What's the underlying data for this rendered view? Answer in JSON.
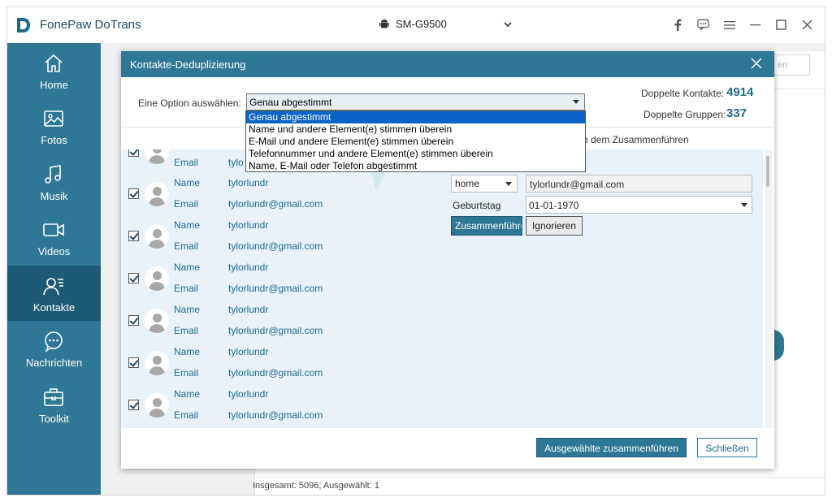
{
  "app": {
    "title": "FonePaw DoTrans",
    "device": "SM-G9500"
  },
  "sidebar": {
    "items": [
      {
        "label": "Home",
        "icon": "home-icon"
      },
      {
        "label": "Fotos",
        "icon": "photo-icon"
      },
      {
        "label": "Musik",
        "icon": "music-icon"
      },
      {
        "label": "Videos",
        "icon": "video-icon"
      },
      {
        "label": "Kontakte",
        "icon": "contacts-icon",
        "active": true
      },
      {
        "label": "Nachrichten",
        "icon": "message-icon"
      },
      {
        "label": "Toolkit",
        "icon": "toolkit-icon"
      }
    ]
  },
  "background": {
    "search_hint": "en",
    "status": "Insgesamt: 5096; Ausgewählt: 1"
  },
  "dialog": {
    "title": "Kontakte-Deduplizierung",
    "option_label": "Eine Option auswählen:",
    "selected_option": "Genau abgestimmt",
    "options": [
      "Genau abgestimmt",
      "Name und andere Element(e) stimmen überein",
      "E-Mail und andere Element(e) stimmen überein",
      "Telefonnummer und andere Element(e) stimmen überein",
      "Name, E-Mail oder Telefon abgestimmt"
    ],
    "stats": {
      "dup_contacts_label": "Doppelte Kontakte:",
      "dup_contacts_value": "4914",
      "dup_groups_label": "Doppelte Gruppen:",
      "dup_groups_value": "337"
    },
    "merge_hint": "ch dem Zusammenführen",
    "rows": [
      {
        "name_label": "Name",
        "name": "tylorlundr",
        "email_label": "Email",
        "email": "tylorlundr@gmail.com"
      },
      {
        "name_label": "Name",
        "name": "tylorlundr",
        "email_label": "Email",
        "email": "tylorlundr@gmail.com"
      },
      {
        "name_label": "Name",
        "name": "tylorlundr",
        "email_label": "Email",
        "email": "tylorlundr@gmail.com"
      },
      {
        "name_label": "Name",
        "name": "tylorlundr",
        "email_label": "Email",
        "email": "tylorlundr@gmail.com"
      },
      {
        "name_label": "Name",
        "name": "tylorlundr",
        "email_label": "Email",
        "email": "tylorlundr@gmail.com"
      },
      {
        "name_label": "Name",
        "name": "tylorlundr",
        "email_label": "Email",
        "email": "tylorlundr@gmail.com"
      }
    ],
    "partial_row": {
      "email_label": "Email",
      "email": "tylo"
    },
    "detail": {
      "email_type": "home",
      "email_value": "tylorlundr@gmail.com",
      "birthday_label": "Geburtstag",
      "birthday_value": "01-01-1970",
      "merge_button": "Zusammenführe",
      "ignore_button": "Ignorieren"
    },
    "footer": {
      "merge_selected": "Ausgewählte zusammenführen",
      "close": "Schließen"
    }
  }
}
